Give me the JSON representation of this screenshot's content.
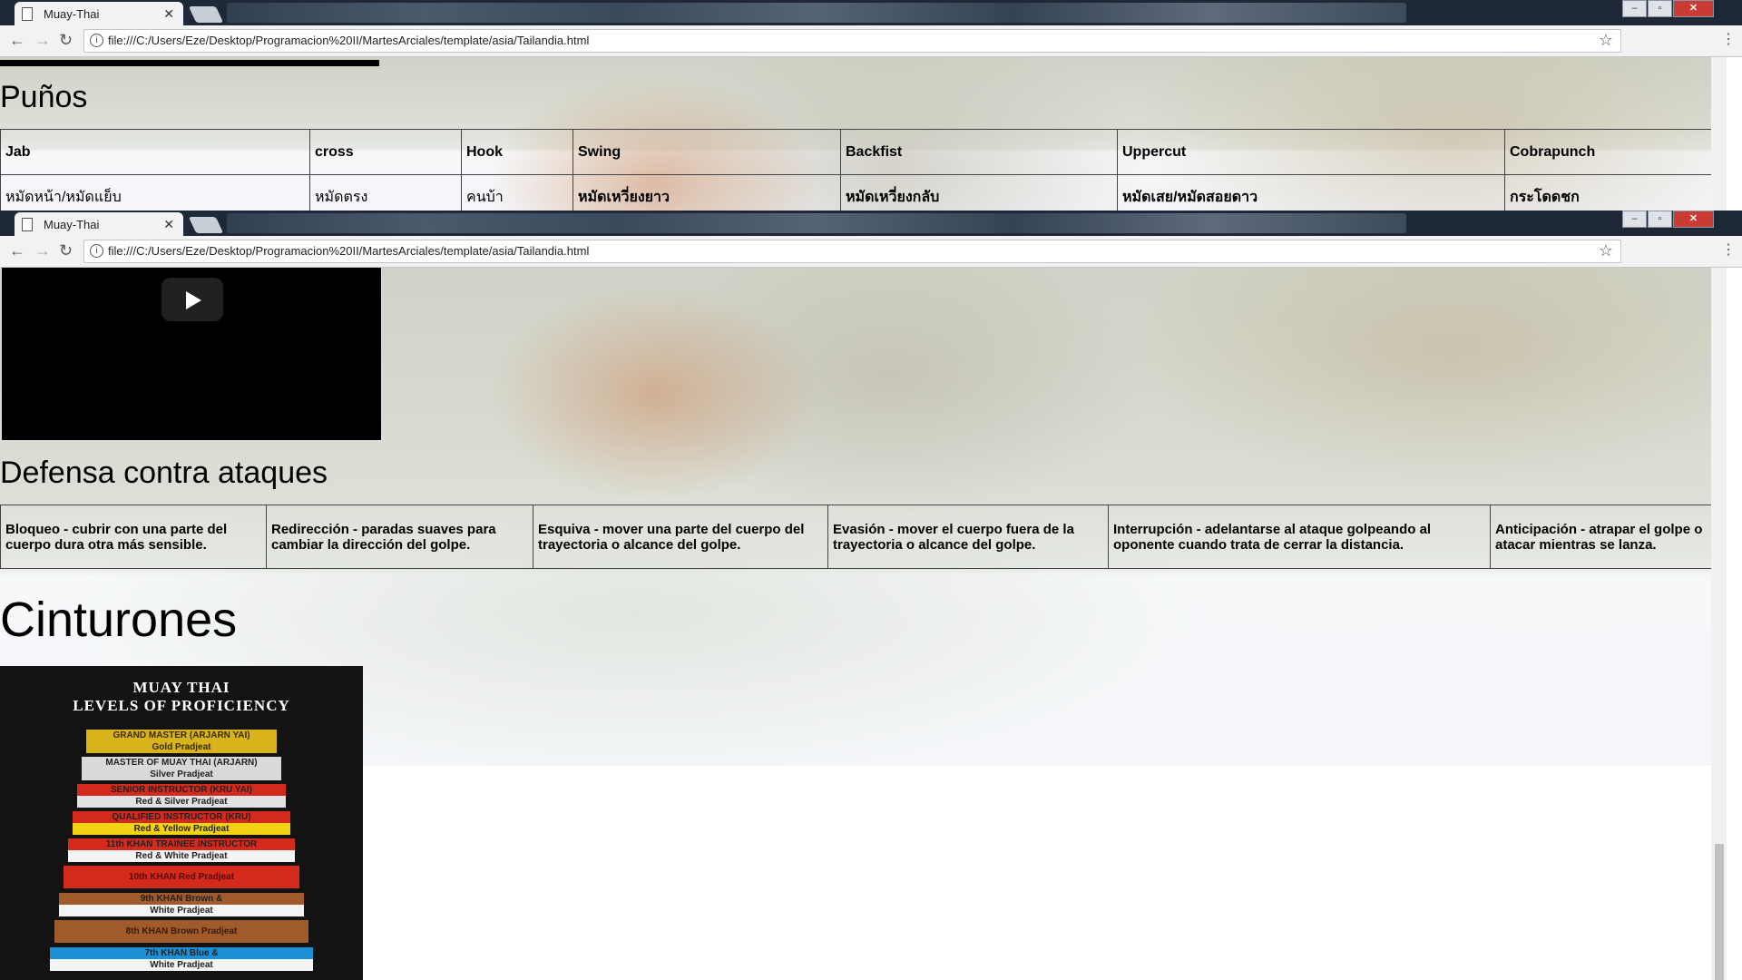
{
  "browser": {
    "tab_title": "Muay-Thai",
    "close_glyph": "✕",
    "url": "file:///C:/Users/Eze/Desktop/Programacion%20II/MartesArciales/template/asia/Tailandia.html",
    "back_glyph": "←",
    "forward_glyph": "→",
    "reload_glyph": "↻",
    "info_glyph": "i",
    "star_glyph": "☆",
    "menu_glyph": "⋮"
  },
  "punos": {
    "heading": "Puños",
    "headers": [
      "Jab",
      "cross",
      "Hook",
      "Swing",
      "Backfist",
      "Uppercut",
      "Cobrapunch"
    ],
    "thai": [
      "หมัดหน้า/หมัดแย็บ",
      "หมัดตรง",
      "คนบ้า",
      "หมัดเหวี่ยงยาว",
      "หมัดเหวี่ยงกลับ",
      "หมัดเสย/หมัดสอยดาว",
      "กระโดดชก"
    ]
  },
  "defensa": {
    "heading": "Defensa contra ataques",
    "cells": [
      "Bloqueo - cubrir con una parte del cuerpo dura otra más sensible.",
      "Redirección - paradas suaves para cambiar la dirección del golpe.",
      "Esquiva - mover una parte del cuerpo del trayectoria o alcance del golpe.",
      "Evasión - mover el cuerpo fuera de la trayectoria o alcance del golpe.",
      "Interrupción - adelantarse al ataque golpeando al oponente cuando trata de cerrar la distancia.",
      "Anticipación - atrapar el golpe o atacar mientras se lanza."
    ]
  },
  "cinturones": {
    "heading": "Cinturones",
    "poster_title_1": "MUAY THAI",
    "poster_title_2": "LEVELS OF PROFICIENCY",
    "belts": [
      {
        "top": "GRAND MASTER (ARJARN YAI)",
        "bottom": "Gold Pradjeat",
        "top_color": "#d8b31c",
        "bottom_color": "#d8b31c",
        "text_color": "#3a2a00"
      },
      {
        "top": "MASTER OF MUAY THAI (ARJARN)",
        "bottom": "Silver Pradjeat",
        "top_color": "#d9d9d9",
        "bottom_color": "#d9d9d9",
        "text_color": "#222"
      },
      {
        "top": "SENIOR INSTRUCTOR (KRU YAI)",
        "bottom": "Red & Silver Pradjeat",
        "top_color": "#d42a1e",
        "bottom_color": "#e2e2e2",
        "text_color": "#222"
      },
      {
        "top": "QUALIFIED INSTRUCTOR (KRU)",
        "bottom": "Red & Yellow Pradjeat",
        "top_color": "#d42a1e",
        "bottom_color": "#f2d313",
        "text_color": "#222"
      },
      {
        "top": "11th KHAN TRAINEE INSTRUCTOR",
        "bottom": "Red & White Pradjeat",
        "top_color": "#d42a1e",
        "bottom_color": "#f4f4f4",
        "text_color": "#222"
      },
      {
        "top": "10th KHAN Red Pradjeat",
        "bottom": "",
        "top_color": "#d42a1e",
        "bottom_color": "#d42a1e",
        "text_color": "#5a0a05"
      },
      {
        "top": "9th KHAN Brown &",
        "bottom": "White Pradjeat",
        "top_color": "#a05a2c",
        "bottom_color": "#f4f4f4",
        "text_color": "#222"
      },
      {
        "top": "8th KHAN Brown Pradjeat",
        "bottom": "",
        "top_color": "#a05a2c",
        "bottom_color": "#a05a2c",
        "text_color": "#3a1a05"
      },
      {
        "top": "7th KHAN Blue &",
        "bottom": "White Pradjeat",
        "top_color": "#1c8fd6",
        "bottom_color": "#f4f4f4",
        "text_color": "#222"
      }
    ]
  }
}
